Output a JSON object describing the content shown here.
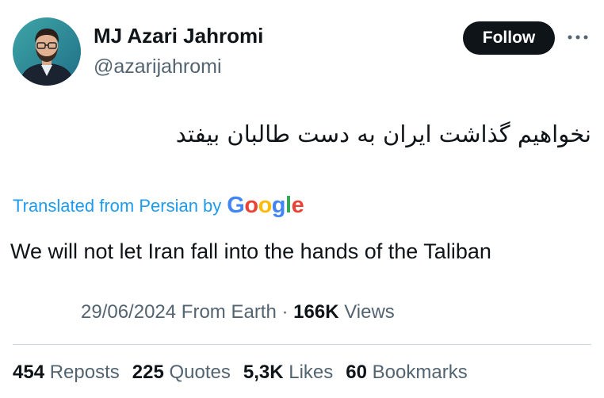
{
  "author": {
    "display_name": "MJ Azari Jahromi",
    "handle": "@azarijahromi",
    "avatar_icon": "profile-photo"
  },
  "follow_button": {
    "label": "Follow"
  },
  "more_button": {
    "icon": "more-horizontal-icon"
  },
  "tweet": {
    "original_text": "نخواهیم گذاشت ایران به دست طالبان بیفتد",
    "translated_label": "Translated from Persian by",
    "translation_provider": "Google",
    "translated_text": "We will not let Iran fall into the hands of the Taliban"
  },
  "meta": {
    "date": "29/06/2024",
    "location": "From Earth",
    "separator": "·",
    "views_count": "166K",
    "views_label": "Views"
  },
  "stats": [
    {
      "count": "454",
      "label": "Reposts"
    },
    {
      "count": "225",
      "label": "Quotes"
    },
    {
      "count": "5,3K",
      "label": "Likes"
    },
    {
      "count": "60",
      "label": "Bookmarks"
    }
  ],
  "colors": {
    "link_blue": "#1d9bf0",
    "text_primary": "#0f1419",
    "text_secondary": "#536471",
    "divider": "#cfd9de",
    "google_blue": "#4285f4",
    "google_red": "#ea4335",
    "google_yellow": "#fbbc05",
    "google_green": "#34a853"
  }
}
